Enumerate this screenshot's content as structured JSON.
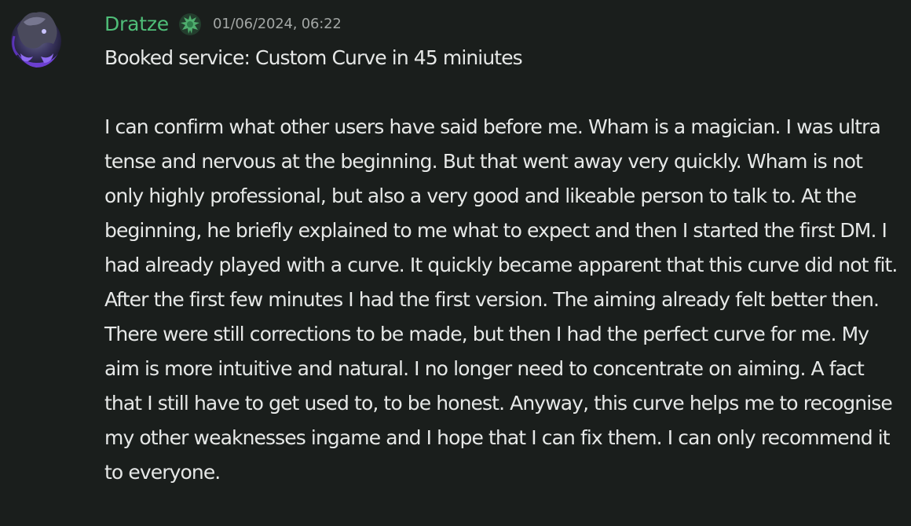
{
  "message": {
    "author": "Dratze",
    "timestamp": "01/06/2024, 06:22",
    "role_icon": "leaf-badge-icon",
    "avatar": "dragon-avatar",
    "line1": "Booked service: Custom Curve in 45 miniutes",
    "paragraph": "I can confirm what other users have said before me. Wham is a magician. I was ultra tense and nervous at the beginning. But that went away very quickly. Wham is not only highly professional, but also a very good and likeable person to talk to. At the beginning, he briefly explained to me what to expect and then I started the first DM. I had already played with a curve. It quickly became apparent that this curve did not fit. After the first few minutes I had the first version. The aiming already felt better then. There were still corrections to be made, but then I had the perfect curve for me. My aim is more intuitive and natural. I no longer need to concentrate on aiming. A fact that I still have to get used to, to be honest. Anyway, this curve helps me to recognise my other weaknesses ingame and I hope that I can fix them. I can only recommend it to everyone."
  },
  "colors": {
    "background": "#1a1e1c",
    "username": "#4fbd78",
    "text": "#e6e8e7",
    "timestamp": "#a3a7a5"
  }
}
